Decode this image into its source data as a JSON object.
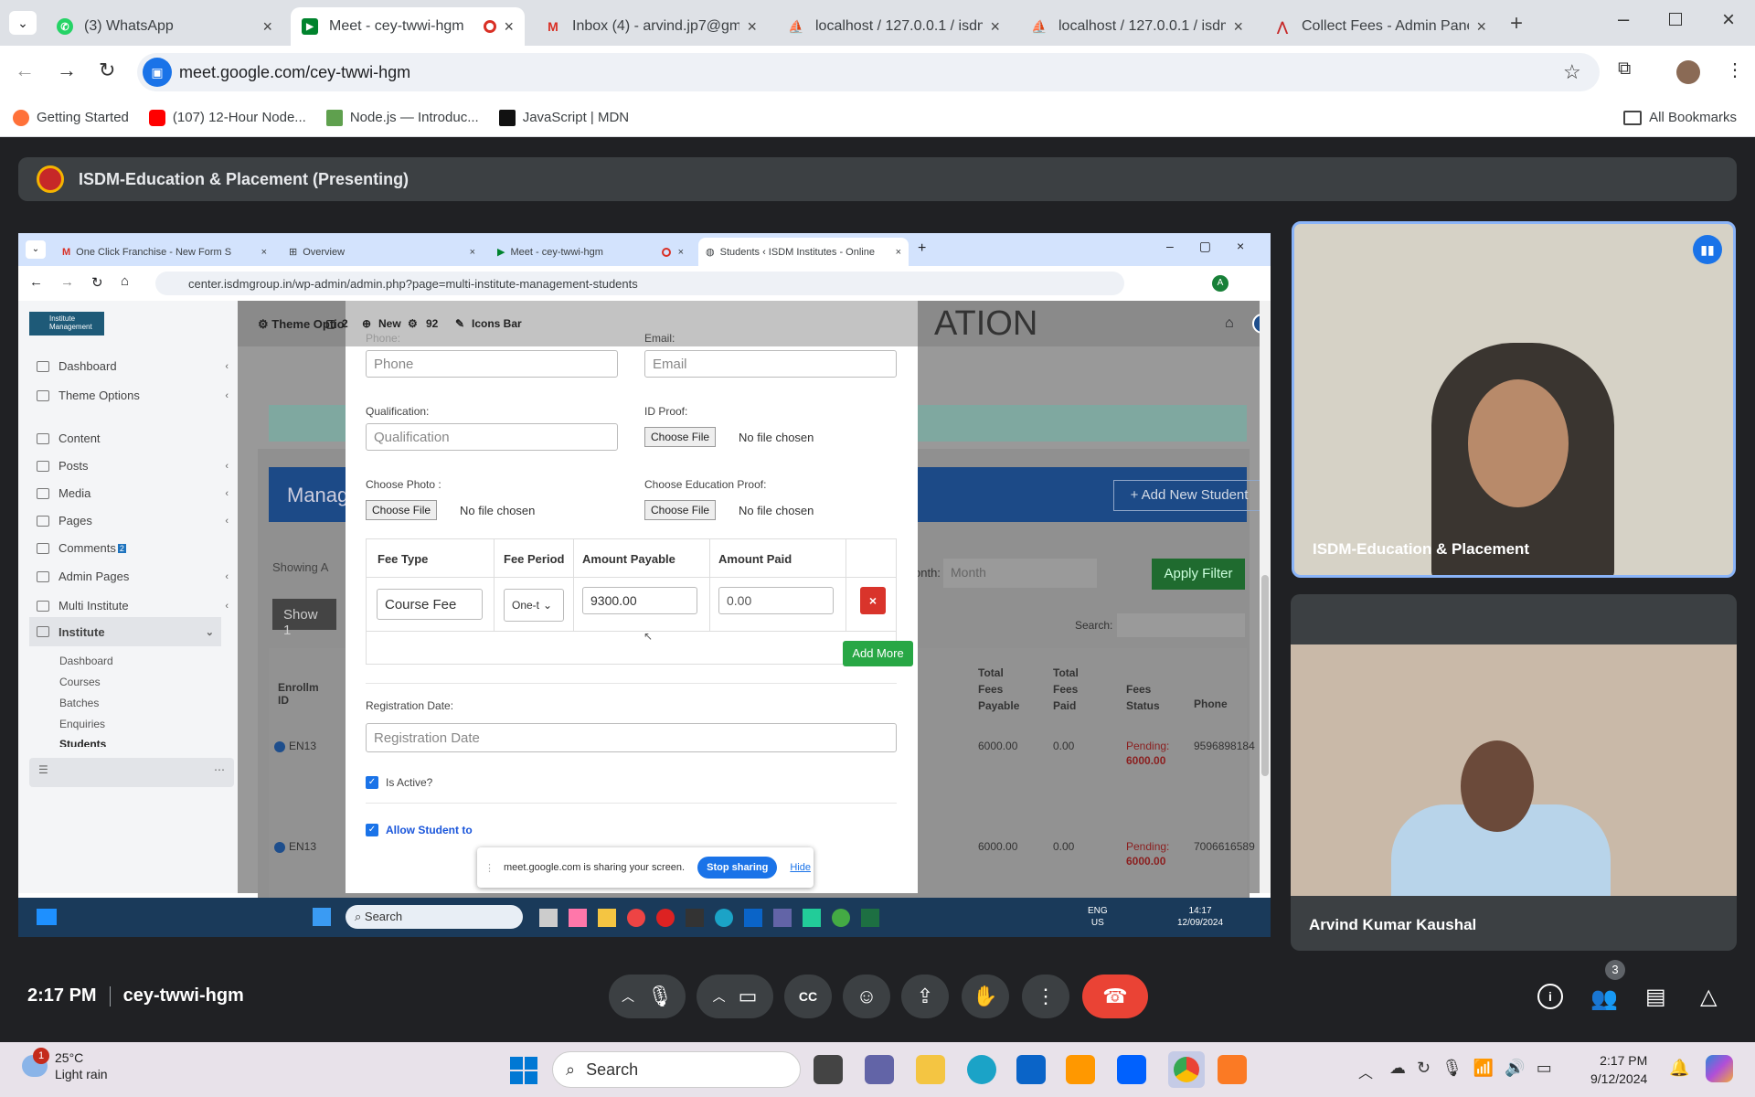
{
  "outer_tabs": [
    {
      "title": "(3) WhatsApp",
      "icon": "whatsapp-icon",
      "active": false
    },
    {
      "title": "Meet - cey-twwi-hgm",
      "icon": "google-meet-icon",
      "active": true
    },
    {
      "title": "Inbox (4) - arvind.jp7@gm",
      "icon": "gmail-icon",
      "active": false
    },
    {
      "title": "localhost / 127.0.0.1 / isdm",
      "icon": "phpmyadmin-icon",
      "active": false
    },
    {
      "title": "localhost / 127.0.0.1 / isdm",
      "icon": "phpmyadmin-icon",
      "active": false
    },
    {
      "title": "Collect Fees - Admin Panel",
      "icon": "admin-icon",
      "active": false
    }
  ],
  "address": "meet.google.com/cey-twwi-hgm",
  "bookmarks": [
    "Getting Started",
    "(107) 12-Hour Node...",
    "Node.js — Introduc...",
    "JavaScript | MDN"
  ],
  "all_bookmarks": "All Bookmarks",
  "presenting": "ISDM-Education & Placement (Presenting)",
  "inner": {
    "tabs": [
      "One Click Franchise - New Form S",
      "Overview",
      "Meet - cey-twwi-hgm",
      "Students ‹ ISDM Institutes - Online"
    ],
    "address": "center.isdmgroup.in/wp-admin/admin.php?page=multi-institute-management-students",
    "avatar_letter": "A",
    "logo": "Institute Management",
    "sidebar": [
      "Dashboard",
      "Theme Options",
      "Content",
      "Posts",
      "Media",
      "Pages",
      "Comments",
      "Admin Pages",
      "Multi Institute",
      "Institute"
    ],
    "comments_count": "2",
    "sub_menu": [
      "Dashboard",
      "Courses",
      "Batches",
      "Enquiries",
      "Students"
    ],
    "adminbar": {
      "theme_options": "Theme Options",
      "comments": "2",
      "new": "New",
      "count": "92",
      "icons_bar": "Icons Bar"
    },
    "bg": {
      "heading": "ATION",
      "manage": "Manag",
      "add_new": "+ Add New Student",
      "showing": "Showing A",
      "show": "Show 1",
      "month_label": "onth:",
      "month_placeholder": "Month",
      "apply": "Apply Filter",
      "search": "Search:",
      "cols": [
        "Enrollm ID",
        "Total Fees Payable",
        "Total Fees Paid",
        "Fees Status",
        "Phone"
      ],
      "rows": [
        {
          "id": "EN13",
          "payable": "6000.00",
          "paid": "0.00",
          "status": "Pending:",
          "amt": "6000.00",
          "phone": "9596898184"
        },
        {
          "id": "EN13",
          "payable": "6000.00",
          "paid": "0.00",
          "status": "Pending:",
          "amt": "6000.00",
          "phone": "7006616589"
        }
      ]
    },
    "form": {
      "phone_label": "Phone:",
      "phone_ph": "Phone",
      "email_label": "Email:",
      "email_ph": "Email",
      "qual_label": "Qualification:",
      "qual_ph": "Qualification",
      "idproof_label": "ID Proof:",
      "photo_label": "Choose Photo :",
      "edu_label": "Choose Education Proof:",
      "choose_file": "Choose File",
      "no_file": "No file chosen",
      "fee_headers": [
        "Fee Type",
        "Fee Period",
        "Amount Payable",
        "Amount Paid"
      ],
      "fee_type": "Course Fee",
      "fee_period": "One-t",
      "amount_payable": "9300.00",
      "amount_paid": "0.00",
      "add_more": "Add More",
      "reg_label": "Registration Date:",
      "reg_ph": "Registration Date",
      "is_active": "Is Active?",
      "allow": "Allow Student to"
    },
    "share_msg": "meet.google.com is sharing your screen.",
    "stop_sharing": "Stop sharing",
    "hide": "Hide",
    "taskbar": {
      "search": "Search",
      "lang": "ENG",
      "region": "US",
      "time": "14:17",
      "date": "12/09/2024"
    }
  },
  "tiles": [
    {
      "name": "ISDM-Education & Placement"
    },
    {
      "name": "Arvind Kumar Kaushal"
    }
  ],
  "meeting": {
    "time": "2:17 PM",
    "code": "cey-twwi-hgm",
    "participants": "3"
  },
  "win": {
    "temp": "25°C",
    "weather": "Light rain",
    "badge": "1",
    "search": "Search",
    "time": "2:17 PM",
    "date": "9/12/2024"
  },
  "colors": {
    "meet_bg": "#202124",
    "end_call": "#ea4335",
    "wp_blue": "#1e73be",
    "green": "#28a745",
    "red": "#d9342b"
  }
}
